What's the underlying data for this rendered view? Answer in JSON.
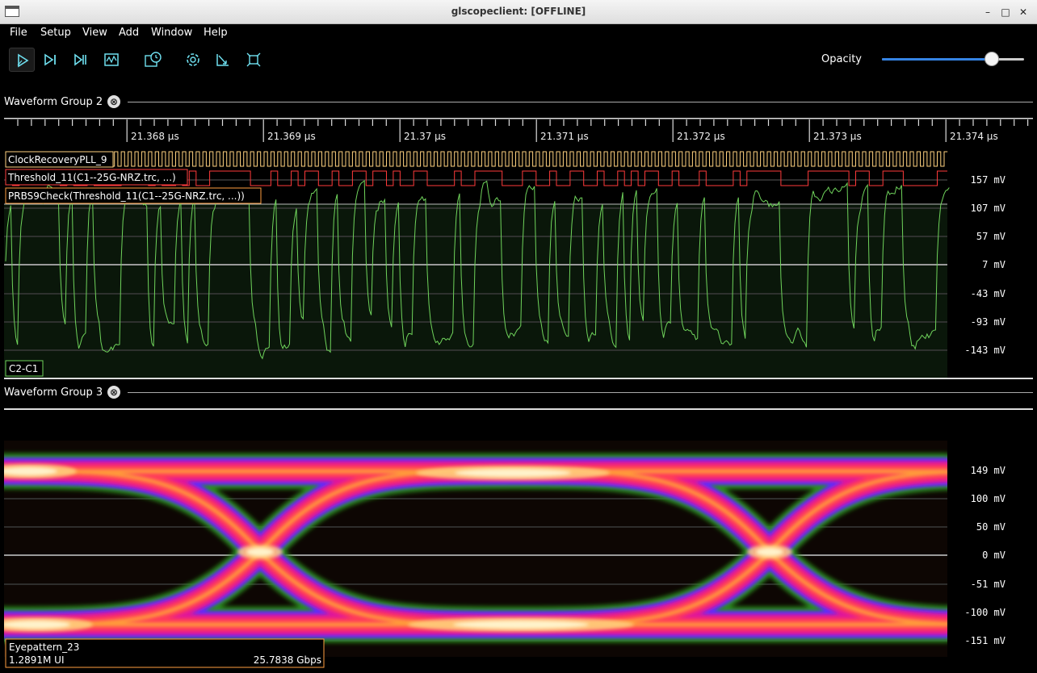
{
  "window": {
    "title": "glscopeclient: [OFFLINE]",
    "minimize_icon": "–",
    "maximize_icon": "□",
    "close_icon": "✕"
  },
  "menu": [
    "File",
    "Setup",
    "View",
    "Add",
    "Window",
    "Help"
  ],
  "toolbar": {
    "buttons": [
      "start-trigger-icon",
      "single-trigger-icon",
      "force-trigger-icon",
      "stop-trigger-icon",
      "history-icon",
      "refresh-icon",
      "fullscreen-icon",
      "zoom-fit-icon"
    ],
    "opacity_label": "Opacity",
    "opacity_value": 0.77,
    "accent": "#3584e4"
  },
  "group2": {
    "title": "Waveform Group 2",
    "close_icon": "⊗",
    "timeline": [
      "21.368 μs",
      "21.369 μs",
      "21.37 μs",
      "21.371 μs",
      "21.372 μs",
      "21.373 μs",
      "21.374 μs"
    ],
    "channels": [
      {
        "name": "ClockRecoveryPLL_9",
        "color": "#ffd27f"
      },
      {
        "name": "Threshold_11(C1--25G-NRZ.trc, ...)",
        "color": "#ff4040"
      },
      {
        "name": "PRBS9Check(Threshold_11(C1--25G-NRZ.trc, ...))",
        "color": "#ff9e40"
      }
    ],
    "analog_channel": {
      "name": "C2-C1",
      "color": "#7fd36b"
    },
    "y_labels": [
      "157 mV",
      "107 mV",
      "57 mV",
      "7 mV",
      "-43 mV",
      "-93 mV",
      "-143 mV"
    ]
  },
  "group3": {
    "title": "Waveform Group 3",
    "close_icon": "⊗",
    "y_labels": [
      "149 mV",
      "100 mV",
      "50 mV",
      "0 mV",
      "-51 mV",
      "-100 mV",
      "-151 mV"
    ],
    "eye": {
      "name": "Eyepattern_23",
      "ui_count": "1.2891M UI",
      "rate": "25.7838 Gbps",
      "color": "#ff9e40"
    }
  }
}
